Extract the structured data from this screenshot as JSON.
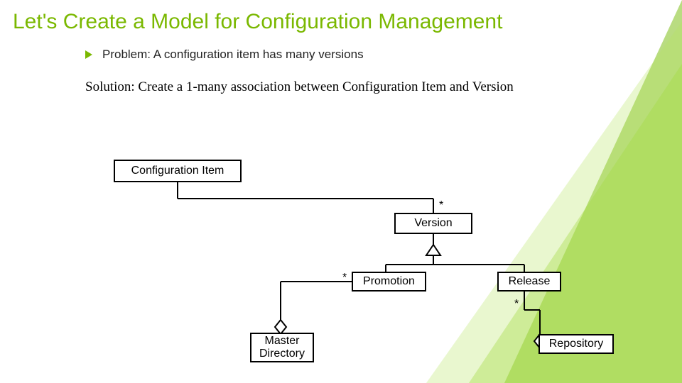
{
  "title": "Let's Create a Model for Configuration\nManagement",
  "subtitle": "Problem: A configuration item has many versions",
  "solution": "Solution: Create  a 1-many association between Configuration Item and Version",
  "boxes": {
    "config_item": "Configuration Item",
    "version": "Version",
    "promotion": "Promotion",
    "release": "Release",
    "master_dir": "Master\nDirectory",
    "repository": "Repository"
  },
  "multiplicity": {
    "star1": "*",
    "star2": "*",
    "star3": "*"
  }
}
